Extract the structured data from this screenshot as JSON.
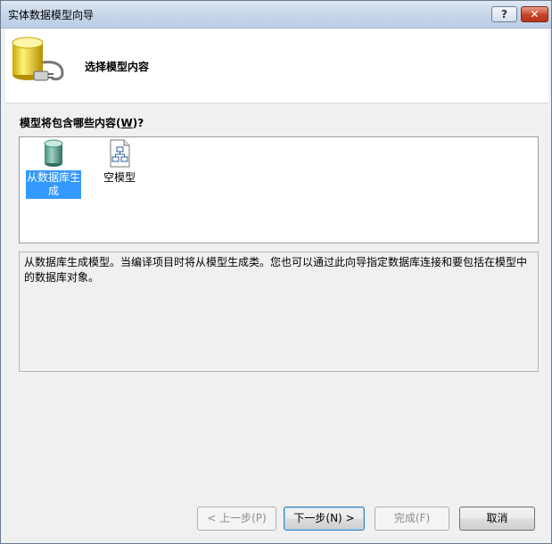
{
  "window": {
    "title": "实体数据模型向导",
    "help_label": "?",
    "close_label": "✕"
  },
  "header": {
    "title": "选择模型内容",
    "logo_icon": "database-plug-icon"
  },
  "content": {
    "label_prefix": "模型将包含哪些内容(",
    "label_hotkey": "W",
    "label_suffix": ")?",
    "items": [
      {
        "label": "从数据库生成",
        "icon": "database-icon",
        "selected": true
      },
      {
        "label": "空模型",
        "icon": "empty-model-icon",
        "selected": false
      }
    ],
    "description": "从数据库生成模型。当编译项目时将从模型生成类。您也可以通过此向导指定数据库连接和要包括在模型中的数据库对象。"
  },
  "buttons": {
    "back": "< 上一步(P)",
    "next": "下一步(N) >",
    "finish": "完成(F)",
    "cancel": "取消"
  },
  "colors": {
    "selection": "#3399ff",
    "title_gradient_top": "#dfe8f3",
    "close_red": "#c44326"
  }
}
